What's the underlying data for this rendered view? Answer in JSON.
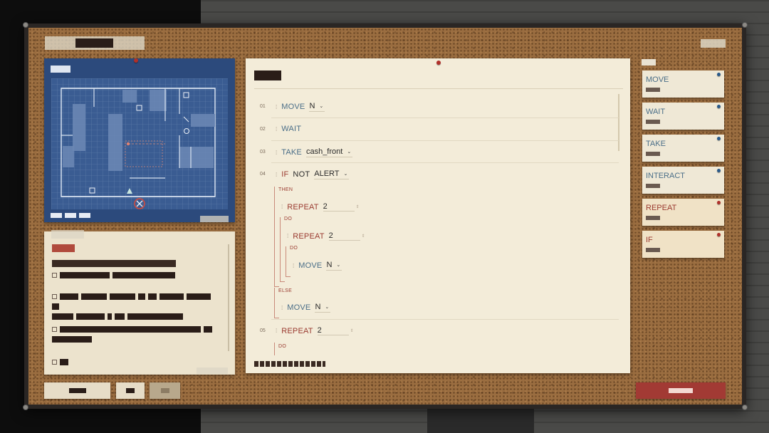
{
  "colors": {
    "cork": "#9a6d40",
    "map_bg": "#2c4a7c",
    "paper": "#f3ecd9",
    "keyword_blue": "#4a6e88",
    "keyword_red": "#9a3a30",
    "submit": "#a23a34"
  },
  "icons": {
    "map_marker": "x-in-circle-icon",
    "player": "triangle-icon",
    "guard": "circle-icon",
    "drag_handle": "grip-icon",
    "dropdown": "chevron-down-icon"
  },
  "program": {
    "lines": [
      {
        "num": "01",
        "cmd": "MOVE",
        "arg": "N"
      },
      {
        "num": "02",
        "cmd": "WAIT"
      },
      {
        "num": "03",
        "cmd": "TAKE",
        "arg": "cash_front"
      },
      {
        "num": "04",
        "cmd": "IF",
        "mod": "NOT",
        "arg": "ALERT"
      },
      {
        "num": "05",
        "cmd": "REPEAT",
        "arg": "2"
      }
    ],
    "labels": {
      "then": "THEN",
      "do": "DO",
      "else": "ELSE"
    },
    "nested": {
      "repeat1": {
        "cmd": "REPEAT",
        "arg": "2"
      },
      "repeat2": {
        "cmd": "REPEAT",
        "arg": "2"
      },
      "move_inner": {
        "cmd": "MOVE",
        "arg": "N"
      },
      "move_else": {
        "cmd": "MOVE",
        "arg": "N"
      }
    }
  },
  "palette": [
    {
      "label": "MOVE",
      "tone": "blue"
    },
    {
      "label": "WAIT",
      "tone": "blue"
    },
    {
      "label": "TAKE",
      "tone": "blue"
    },
    {
      "label": "INTERACT",
      "tone": "blue"
    },
    {
      "label": "REPEAT",
      "tone": "red"
    },
    {
      "label": "IF",
      "tone": "red"
    }
  ]
}
